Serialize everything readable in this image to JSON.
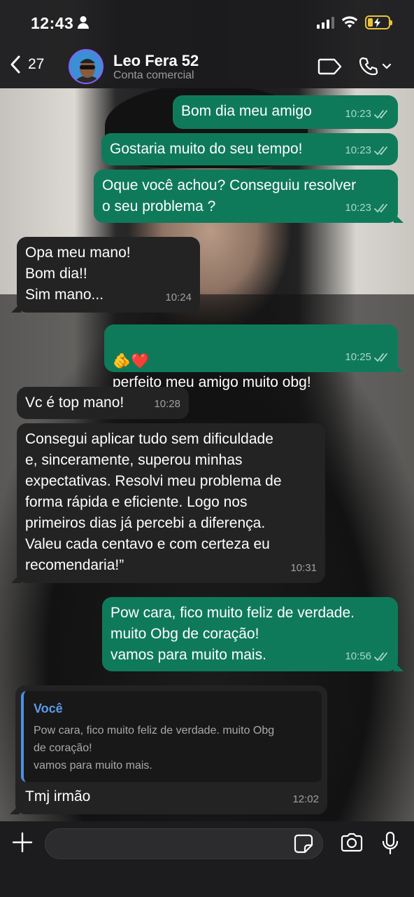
{
  "status_bar": {
    "time": "12:43"
  },
  "header": {
    "back_count": "27",
    "contact_name": "Leo Fera 52",
    "contact_subtitle": "Conta comercial"
  },
  "messages": [
    {
      "dir": "out",
      "text": "Bom dia meu amigo",
      "time": "10:23"
    },
    {
      "dir": "out",
      "text": "Gostaria muito do seu tempo!",
      "time": "10:23"
    },
    {
      "dir": "out",
      "text": "Oque você achou? Conseguiu resolver\no seu problema ?",
      "time": "10:23"
    },
    {
      "dir": "in",
      "text": "Opa meu mano!\nBom dia!!\nSim mano...",
      "time": "10:24"
    },
    {
      "dir": "out",
      "text": "perfeito meu amigo muito obg!",
      "emoji": "🫵❤️",
      "time": "10:25"
    },
    {
      "dir": "in",
      "text": "Vc é top mano!",
      "time": "10:28"
    },
    {
      "dir": "in",
      "text": "Consegui aplicar tudo sem dificuldade\ne, sinceramente, superou minhas\nexpectativas. Resolvi meu problema de\nforma rápida e eficiente. Logo nos\nprimeiros dias já percebi a diferença.\nValeu cada centavo e com certeza eu\nrecomendaria!”",
      "time": "10:31"
    },
    {
      "dir": "out",
      "text": "Pow cara, fico muito feliz de verdade.\nmuito Obg de coração!\nvamos para muito mais.",
      "time": "10:56"
    },
    {
      "dir": "in",
      "text": "Tmj irmão",
      "time": "12:02",
      "quote": {
        "author": "Você",
        "text": "Pow cara, fico muito feliz de verdade. muito Obg\nde coração!\nvamos para muito mais."
      }
    }
  ],
  "input": {
    "placeholder": ""
  },
  "colors": {
    "outgoing": "#0f7a5a",
    "incoming": "#232323",
    "quote_accent": "#4d8fe0",
    "battery": "#e8c33a"
  },
  "icons": [
    "person-icon",
    "signal-icon",
    "wifi-icon",
    "battery-icon",
    "back-chevron-icon",
    "video-call-icon",
    "phone-icon",
    "chevron-down-icon",
    "plus-icon",
    "sticker-icon",
    "camera-icon",
    "microphone-icon",
    "double-check-icon"
  ]
}
